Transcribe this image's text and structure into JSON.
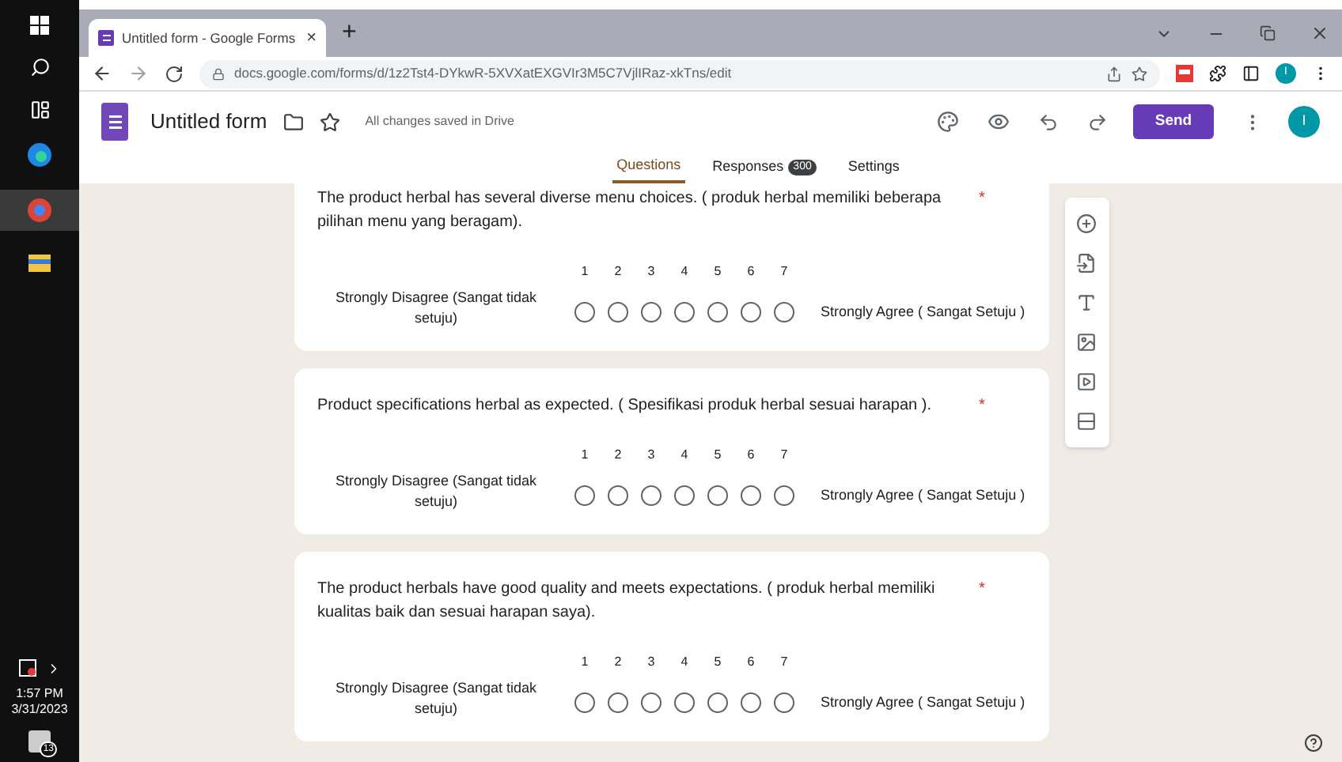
{
  "taskbar": {
    "time": "1:57 PM",
    "date": "3/31/2023",
    "notification_count": "13"
  },
  "browser": {
    "tab_title": "Untitled form - Google Forms",
    "tab_close": "×",
    "new_tab": "+",
    "url": "docs.google.com/forms/d/1z2Tst4-DYkwR-5XVXatEXGVIr3M5C7VjlIRaz-xkTns/edit",
    "profile_initial": "I"
  },
  "form_header": {
    "title": "Untitled form",
    "save_status": "All changes saved in Drive",
    "send_button": "Send",
    "avatar_initial": "I"
  },
  "tabs": [
    {
      "label": "Questions",
      "selected": true
    },
    {
      "label": "Responses",
      "badge": "300",
      "selected": false
    },
    {
      "label": "Settings",
      "selected": false
    }
  ],
  "questions": [
    {
      "text": "The product herbal has several diverse menu choices. ( produk herbal memiliki beberapa pilihan menu yang beragam).",
      "required_mark": "*",
      "scale": [
        {
          "label": "1",
          "selected": false
        },
        {
          "label": "2",
          "selected": false
        },
        {
          "label": "3",
          "selected": false
        },
        {
          "label": "4",
          "selected": false
        },
        {
          "label": "5",
          "selected": false
        },
        {
          "label": "6",
          "selected": false
        },
        {
          "label": "7",
          "selected": false
        }
      ],
      "low_label": "Strongly Disagree (Sangat tidak setuju)",
      "high_label": "Strongly Agree ( Sangat Setuju )"
    },
    {
      "text": "Product specifications herbal as expected. ( Spesifikasi produk herbal sesuai harapan ).",
      "required_mark": "*",
      "scale": [
        {
          "label": "1",
          "selected": false
        },
        {
          "label": "2",
          "selected": false
        },
        {
          "label": "3",
          "selected": false
        },
        {
          "label": "4",
          "selected": false
        },
        {
          "label": "5",
          "selected": false
        },
        {
          "label": "6",
          "selected": false
        },
        {
          "label": "7",
          "selected": false
        }
      ],
      "low_label": "Strongly Disagree (Sangat tidak setuju)",
      "high_label": "Strongly Agree ( Sangat Setuju )"
    },
    {
      "text": "The product herbals have good quality and meets expectations. ( produk herbal memiliki kualitas baik dan sesuai harapan saya).",
      "required_mark": "*",
      "scale": [
        {
          "label": "1",
          "selected": false
        },
        {
          "label": "2",
          "selected": false
        },
        {
          "label": "3",
          "selected": false
        },
        {
          "label": "4",
          "selected": false
        },
        {
          "label": "5",
          "selected": false
        },
        {
          "label": "6",
          "selected": false
        },
        {
          "label": "7",
          "selected": false
        }
      ],
      "low_label": "Strongly Disagree (Sangat tidak setuju)",
      "high_label": "Strongly Agree ( Sangat Setuju )"
    }
  ]
}
